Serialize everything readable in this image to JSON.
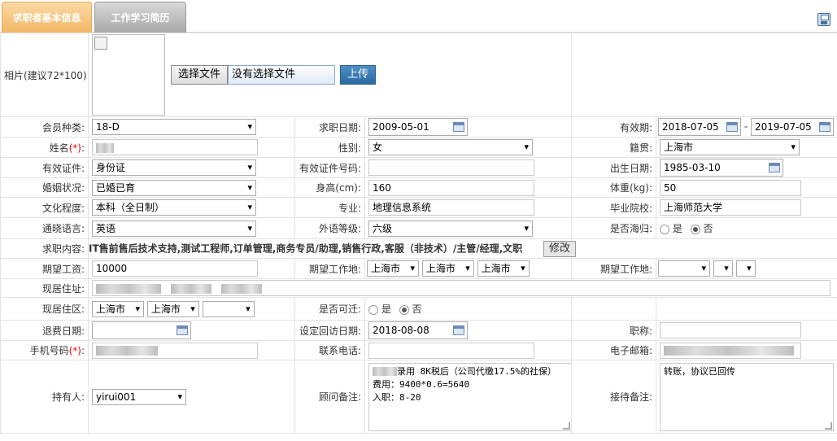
{
  "tabs": [
    {
      "label": "求职者基本信息"
    },
    {
      "label": "工作学习简历"
    }
  ],
  "photo": {
    "label": "相片(建议72*100):",
    "choose_label": "选择文件",
    "file_status": "没有选择文件",
    "upload_label": "上传"
  },
  "fields": {
    "member_type": {
      "label": "会员种类:",
      "value": "18-D"
    },
    "apply_date": {
      "label": "求职日期:",
      "value": "2009-05-01"
    },
    "valid_period": {
      "label": "有效期:",
      "from": "2018-07-05",
      "sep": "-",
      "to": "2019-07-05"
    },
    "name": {
      "label": "姓名",
      "req": "(*)",
      "colon": ":"
    },
    "gender": {
      "label": "性别:",
      "value": "女"
    },
    "native_place": {
      "label": "籍贯:",
      "value": "上海市"
    },
    "id_type": {
      "label": "有效证件:",
      "value": "身份证"
    },
    "id_number": {
      "label": "有效证件号码:",
      "value": ""
    },
    "birth_date": {
      "label": "出生日期:",
      "value": "1985-03-10"
    },
    "marital": {
      "label": "婚姻状况:",
      "value": "已婚已育"
    },
    "height": {
      "label": "身高(cm):",
      "value": "160"
    },
    "weight": {
      "label": "体重(kg):",
      "value": "50"
    },
    "education": {
      "label": "文化程度:",
      "value": "本科（全日制）"
    },
    "major": {
      "label": "专业:",
      "value": "地理信息系统"
    },
    "school": {
      "label": "毕业院校:",
      "value": "上海师范大学"
    },
    "language": {
      "label": "通晓语言:",
      "value": "英语"
    },
    "lang_level": {
      "label": "外语等级:",
      "value": "六级"
    },
    "returnee": {
      "label": "是否海归:",
      "yes": "是",
      "no": "否"
    },
    "job_content": {
      "label": "求职内容:",
      "value": "IT售前售后技术支持,测试工程师,订单管理,商务专员/助理,销售行政,客服（非技术）/主管/经理,文职",
      "edit_label": "修改"
    },
    "expected_salary": {
      "label": "期望工资:",
      "value": "10000"
    },
    "expected_location": {
      "label": "期望工作地:",
      "p1": "上海市",
      "p2": "上海市",
      "p3": "上海市"
    },
    "expected_location2": {
      "label": "期望工作地:"
    },
    "address": {
      "label": "现居住址:"
    },
    "district": {
      "label": "现居住区:",
      "p1": "上海市",
      "p2": "上海市",
      "p3": ""
    },
    "relocate": {
      "label": "是否可迁:",
      "yes": "是",
      "no": "否"
    },
    "refund_date": {
      "label": "退费日期:",
      "value": ""
    },
    "callback_date": {
      "label": "设定回访日期:",
      "value": "2018-08-08"
    },
    "title": {
      "label": "职称:",
      "value": ""
    },
    "mobile": {
      "label": "手机号码",
      "req": "(*)",
      "colon": ":"
    },
    "phone": {
      "label": "联系电话:",
      "value": ""
    },
    "email": {
      "label": "电子邮箱:"
    },
    "holder": {
      "label": "持有人:",
      "value": "yirui001"
    },
    "advisor_note": {
      "label": "顾问备注:",
      "value": "录用 8K税后（公司代缴17.5%的社保）\n费用：9400*0.6=5640\n入职：8-20"
    },
    "reception_note": {
      "label": "接待备注:",
      "value": "转账，协议已回传"
    }
  },
  "icons": {
    "save": "save-icon",
    "calendar": "calendar-icon"
  }
}
